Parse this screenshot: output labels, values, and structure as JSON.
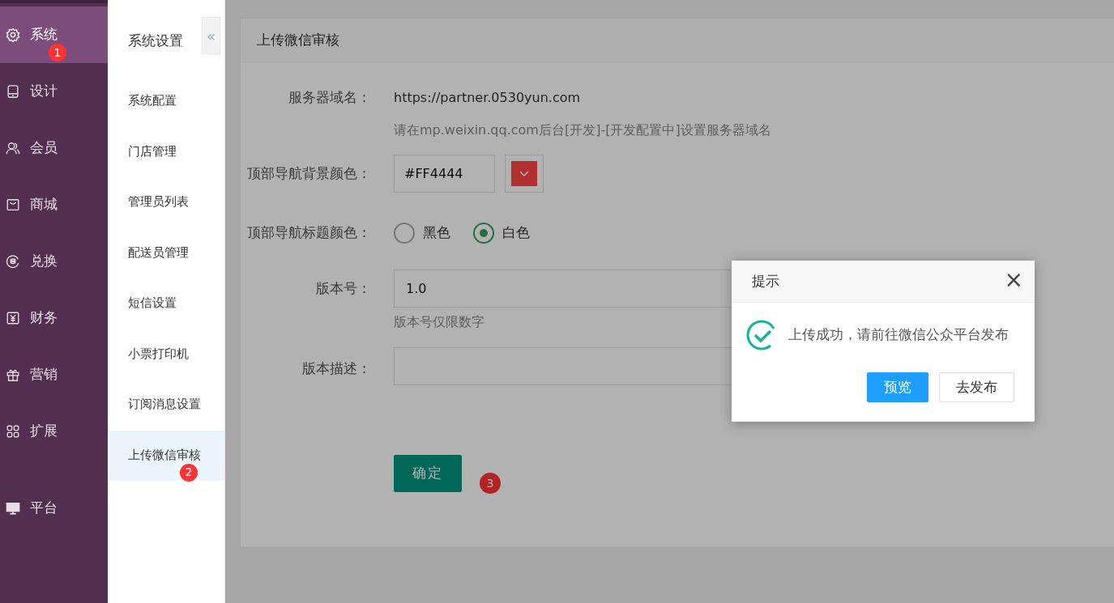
{
  "main_nav": [
    {
      "label": "系统",
      "selected": true,
      "badge": "1"
    },
    {
      "label": "设计",
      "selected": false
    },
    {
      "label": "会员",
      "selected": false
    },
    {
      "label": "商城",
      "selected": false
    },
    {
      "label": "兑换",
      "selected": false
    },
    {
      "label": "财务",
      "selected": false
    },
    {
      "label": "营销",
      "selected": false
    },
    {
      "label": "扩展",
      "selected": false
    }
  ],
  "bottom_nav": [
    {
      "label": "平台",
      "selected": false
    }
  ],
  "sub_nav": {
    "title": "系统设置",
    "collapse": "«",
    "items": [
      {
        "label": "系统配置",
        "selected": false
      },
      {
        "label": "门店管理",
        "selected": false
      },
      {
        "label": "管理员列表",
        "selected": false
      },
      {
        "label": "配送员管理",
        "selected": false
      },
      {
        "label": "短信设置",
        "selected": false
      },
      {
        "label": "小票打印机",
        "selected": false
      },
      {
        "label": "订阅消息设置",
        "selected": false
      },
      {
        "label": "上传微信审核",
        "selected": true,
        "badge": "2"
      }
    ]
  },
  "card": {
    "title": "上传微信审核",
    "fields": [
      {
        "kind": "text",
        "label": "服务器域名：",
        "value": "https://partner.0530yun.com",
        "help": "请在mp.weixin.qq.com后台[开发]-[开发配置中]设置服务器域名"
      },
      {
        "kind": "color",
        "label": "顶部导航背景颜色：",
        "value": "#FF4444"
      },
      {
        "kind": "radio",
        "label": "顶部导航标题颜色：",
        "options": [
          {
            "label": "黑色",
            "selected": false
          },
          {
            "label": "白色",
            "selected": true
          }
        ]
      },
      {
        "kind": "input",
        "label": "版本号：",
        "value": "1.0",
        "help": "版本号仅限数字"
      },
      {
        "kind": "textarea",
        "label": "版本描述："
      }
    ],
    "submit": {
      "label": "确定",
      "badge": "3"
    }
  },
  "dialog": {
    "title": "提示",
    "close": "×",
    "message": "上传成功，请前往微信公众平台发布",
    "buttons": [
      {
        "label": "预览",
        "kind": "primary"
      },
      {
        "label": "去发布",
        "kind": "default"
      }
    ]
  }
}
